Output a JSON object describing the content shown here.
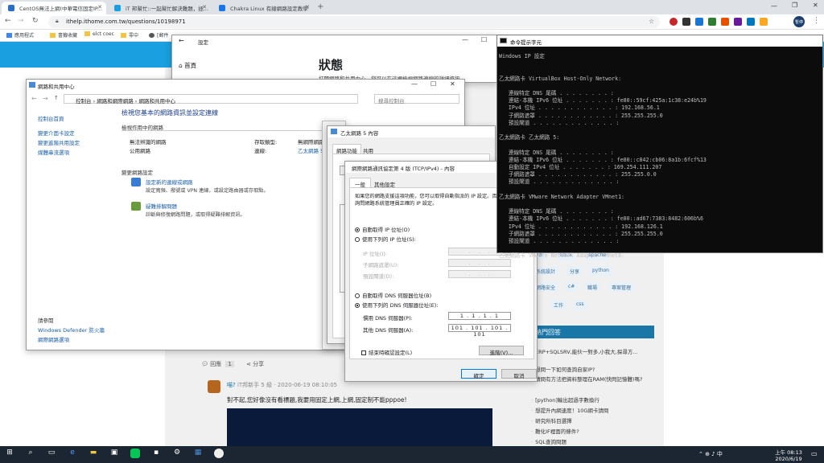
{
  "browser": {
    "tabs": [
      {
        "title": "CentOS無法上網(中華電信固定IP...",
        "color": "#2a6fbf"
      },
      {
        "title": "iT 邦幫忙::一起幫忙解決難題，拯...",
        "color": "#1aa0e0"
      },
      {
        "title": "Chakra Linux 有線網路設定教學",
        "color": "#1a73e8"
      }
    ],
    "url": "ithelp.ithome.com.tw/questions/10198971",
    "bookmarks": [
      "應用程式",
      "書籤收藏",
      "elct coec",
      "零中",
      "[郵件"
    ],
    "avatar": "暫停"
  },
  "settings_win": {
    "title": "設定",
    "home": "首頁",
    "heading": "狀態",
    "sub": "打開網路和共用中心，您可以在這裡檢視網路連線的詳細資訊..."
  },
  "nsc": {
    "title": "網路和共用中心",
    "path": [
      "控制台",
      "網路和網際網路",
      "網路和共用中心"
    ],
    "search": "搜尋控制台",
    "sidebar": [
      "控制台首頁",
      "變更介面卡設定",
      "變更進階共用設定",
      "媒體串流選項"
    ],
    "seealso_title": "請參閱",
    "seealso": [
      "Windows Defender 防火牆",
      "網際網路選項"
    ],
    "heading": "檢視您基本的網路資訊並設定連線",
    "active_label": "檢視作用中的網路",
    "net_name": "無法辨識的網路",
    "net_type": "公用網路",
    "access_label": "存取類型:",
    "access_val": "無網際網路存取",
    "conn_label": "連線:",
    "conn_val": "乙太網路 5",
    "change_label": "變更網路設定",
    "item1_title": "設定新的連線或網路",
    "item1_desc": "設定寬頻、撥號或 VPN 連線，或設定路由器或存取點。",
    "item2_title": "疑難排解問題",
    "item2_desc": "診斷與修復網路問題，或取得疑難排解資訊。"
  },
  "eth_props": {
    "title": "乙太網路 5 內容",
    "tabs": [
      "網路功能",
      "共用"
    ]
  },
  "ipv4": {
    "title": "網際網路通訊協定第 4 版 (TCP/IPv4) - 內容",
    "tabs": [
      "一般",
      "其他設定"
    ],
    "desc": "如果您的網路支援這項功能，您可以取得自動指派的 IP 設定。否則，您必須詢問網路系統管理員正確的 IP 設定。",
    "auto_ip": "自動取得 IP 位址(O)",
    "manual_ip": "使用下列的 IP 位址(S):",
    "ip_label": "IP 位址(I):",
    "mask_label": "子網路遮罩(U):",
    "gw_label": "預設閘道(D):",
    "auto_dns": "自動取得 DNS 伺服器位址(B)",
    "manual_dns": "使用下列的 DNS 伺服器位址(E):",
    "dns1_label": "慣用 DNS 伺服器(P):",
    "dns1": "1 . 1 . 1 . 1",
    "dns2_label": "其他 DNS 伺服器(A):",
    "dns2": "101 . 101 . 101 . 101",
    "validate": "結束時確認設定(L)",
    "advanced": "進階(V)...",
    "ok": "確定",
    "cancel": "取消"
  },
  "cmd": {
    "title": "命令提示字元",
    "lines": [
      "Windows IP 設定",
      "",
      "",
      "乙太網路卡 VirtualBox Host-Only Network:",
      "",
      "   連線特定 DNS 尾碼 . . . . . . . . :",
      "   連結-本機 IPv6 位址 . . . . . . . : fe80::59cf:425a:1c38:e24b%19",
      "   IPv4 位址 . . . . . . . . . . . . : 192.168.56.1",
      "   子網路遮罩 . . . . . . . . . . . . : 255.255.255.0",
      "   預設閘道 . . . . . . . . . . . . . :",
      "",
      "乙太網路卡 乙太網路 5:",
      "",
      "   連線特定 DNS 尾碼 . . . . . . . . :",
      "   連結-本機 IPv6 位址 . . . . . . . : fe80::c842:cb06:8a1b:6fcf%13",
      "   自動設定 IPv4 位址 . . . . . . . : 169.254.111.207",
      "   子網路遮罩 . . . . . . . . . . . . : 255.255.0.0",
      "   預設閘道 . . . . . . . . . . . . . :",
      "",
      "乙太網路卡 VMware Network Adapter VMnet1:",
      "",
      "   連線特定 DNS 尾碼 . . . . . . . . :",
      "   連結-本機 IPv6 位址 . . . . . . . : fe80::ad67:7383:8482:606b%6",
      "   IPv4 位址 . . . . . . . . . . . . : 192.168.126.1",
      "   子網路遮罩 . . . . . . . . . . . . : 255.255.255.0",
      "   預設閘道 . . . . . . . . . . . . . :",
      "",
      "乙太網路卡 VMware Network Adapter VMnet8:"
    ]
  },
  "forum": {
    "tags": [
      "vdi",
      "linux",
      "apache",
      "系統設計",
      "分享",
      "python",
      "網路安全",
      "c#",
      "職場",
      "專案管理",
      "工作",
      "css"
    ],
    "hot_title": "熱門回答",
    "hot": [
      "ERP+SQLSRV,能伙一對多,小我大,探尋方...",
      "想問一下如何查詢自家IP?",
      "請問有方法把資料整理在RAM(快閃記憶體)嗎?",
      "[python]輸出超過字數換行",
      "想提升內網速度！10G網卡請問",
      "研究所科目選擇",
      "難化IF裡面的條件?",
      "SQL查詢問題"
    ],
    "reply_label": "回應",
    "reply_count": "1",
    "share_label": "分享",
    "commenter": "喵?",
    "comment_meta": "iT邦新手 5 級 · 2020-06-19 08:10:05",
    "comment": "對不起,您好像沒有看標題,我要用固定上網,上網,固定制不能pppoe!"
  },
  "taskbar": {
    "time": "上午 08:13",
    "date": "2020/6/19"
  }
}
